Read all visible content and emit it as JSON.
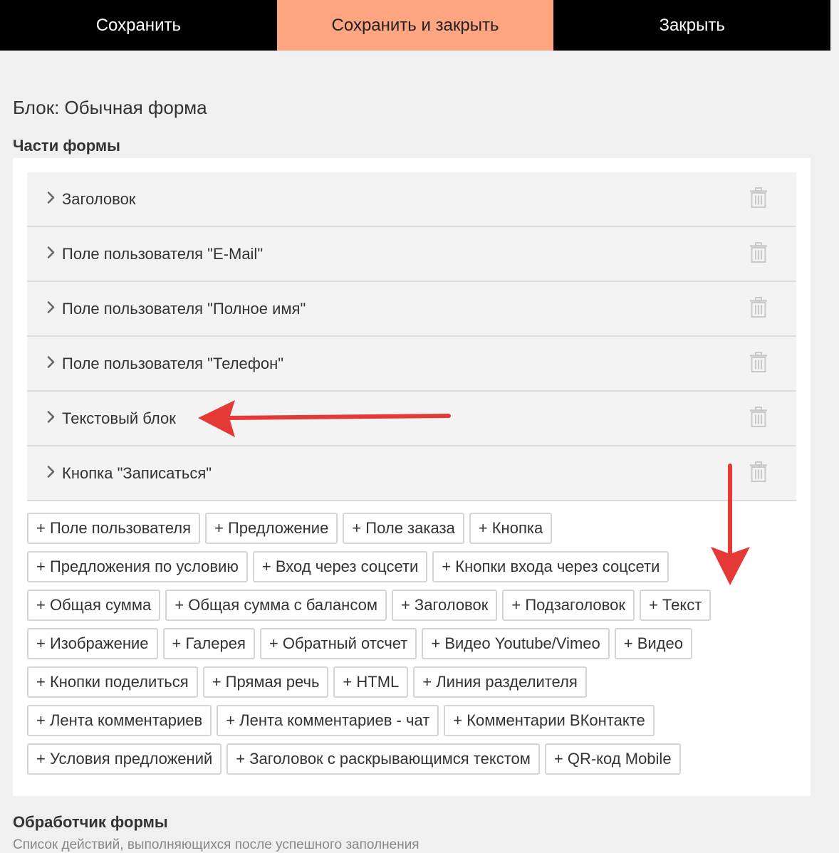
{
  "toolbar": {
    "save": "Сохранить",
    "save_close": "Сохранить и закрыть",
    "close": "Закрыть"
  },
  "block_title": "Блок: Обычная форма",
  "section_parts_title": "Части формы",
  "parts": [
    {
      "label": "Заголовок",
      "icon": "trash-icon"
    },
    {
      "label": "Поле пользователя \"E-Mail\"",
      "icon": "trash-icon"
    },
    {
      "label": "Поле пользователя \"Полное имя\"",
      "icon": "trash-icon"
    },
    {
      "label": "Поле пользователя \"Телефон\"",
      "icon": "trash-icon"
    },
    {
      "label": "Текстовый блок",
      "icon": "trash-icon"
    },
    {
      "label": "Кнопка \"Записаться\"",
      "icon": "trash-icon"
    }
  ],
  "add_buttons": [
    [
      "+ Поле пользователя",
      "+ Предложение",
      "+ Поле заказа",
      "+ Кнопка"
    ],
    [
      "+ Предложения по условию",
      "+ Вход через соцсети",
      "+ Кнопки входа через соцсети"
    ],
    [
      "+ Общая сумма",
      "+ Общая сумма с балансом",
      "+ Заголовок",
      "+ Подзаголовок",
      "+ Текст"
    ],
    [
      "+ Изображение",
      "+ Галерея",
      "+ Обратный отсчет",
      "+ Видео Youtube/Vimeo",
      "+ Видео"
    ],
    [
      "+ Кнопки поделиться",
      "+ Прямая речь",
      "+ HTML",
      "+ Линия разделителя"
    ],
    [
      "+ Лента комментариев",
      "+ Лента комментариев - чат",
      "+ Комментарии ВКонтакте"
    ],
    [
      "+ Условия предложений",
      "+ Заголовок с раскрывающимся текстом",
      "+ QR-код Mobile"
    ]
  ],
  "handler_title": "Обработчик формы",
  "handler_desc": "Список действий, выполняющихся после успешного заполнения",
  "colors": {
    "topbar_bg": "#000000",
    "active_button": "#ffa582",
    "annotation_arrow": "#e53935"
  }
}
